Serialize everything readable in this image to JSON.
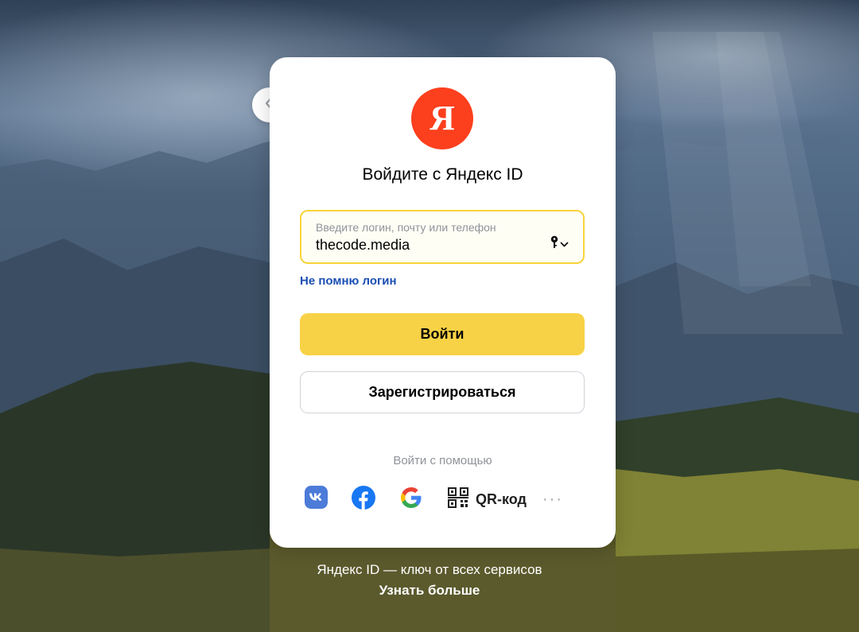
{
  "logo": {
    "letter": "Я",
    "color": "#fc3f1d"
  },
  "title": "Войдите с Яндекс ID",
  "login": {
    "placeholder": "Введите логин, почту или телефон",
    "value": "thecode.media",
    "border_color": "#f8d33b"
  },
  "links": {
    "forgot_login": "Не помню логин"
  },
  "buttons": {
    "login": "Войти",
    "register": "Зарегистрироваться"
  },
  "social": {
    "caption": "Войти с помощью",
    "providers": [
      "vk-icon",
      "facebook-icon",
      "google-icon",
      "qr-icon"
    ],
    "qr_label": "QR-код",
    "more": "···"
  },
  "footer": {
    "tagline": "Яндекс ID — ключ от всех сервисов",
    "learn_more": "Узнать больше"
  },
  "colors": {
    "accent_yellow": "#f8d246",
    "link_blue": "#1b4fb3"
  }
}
